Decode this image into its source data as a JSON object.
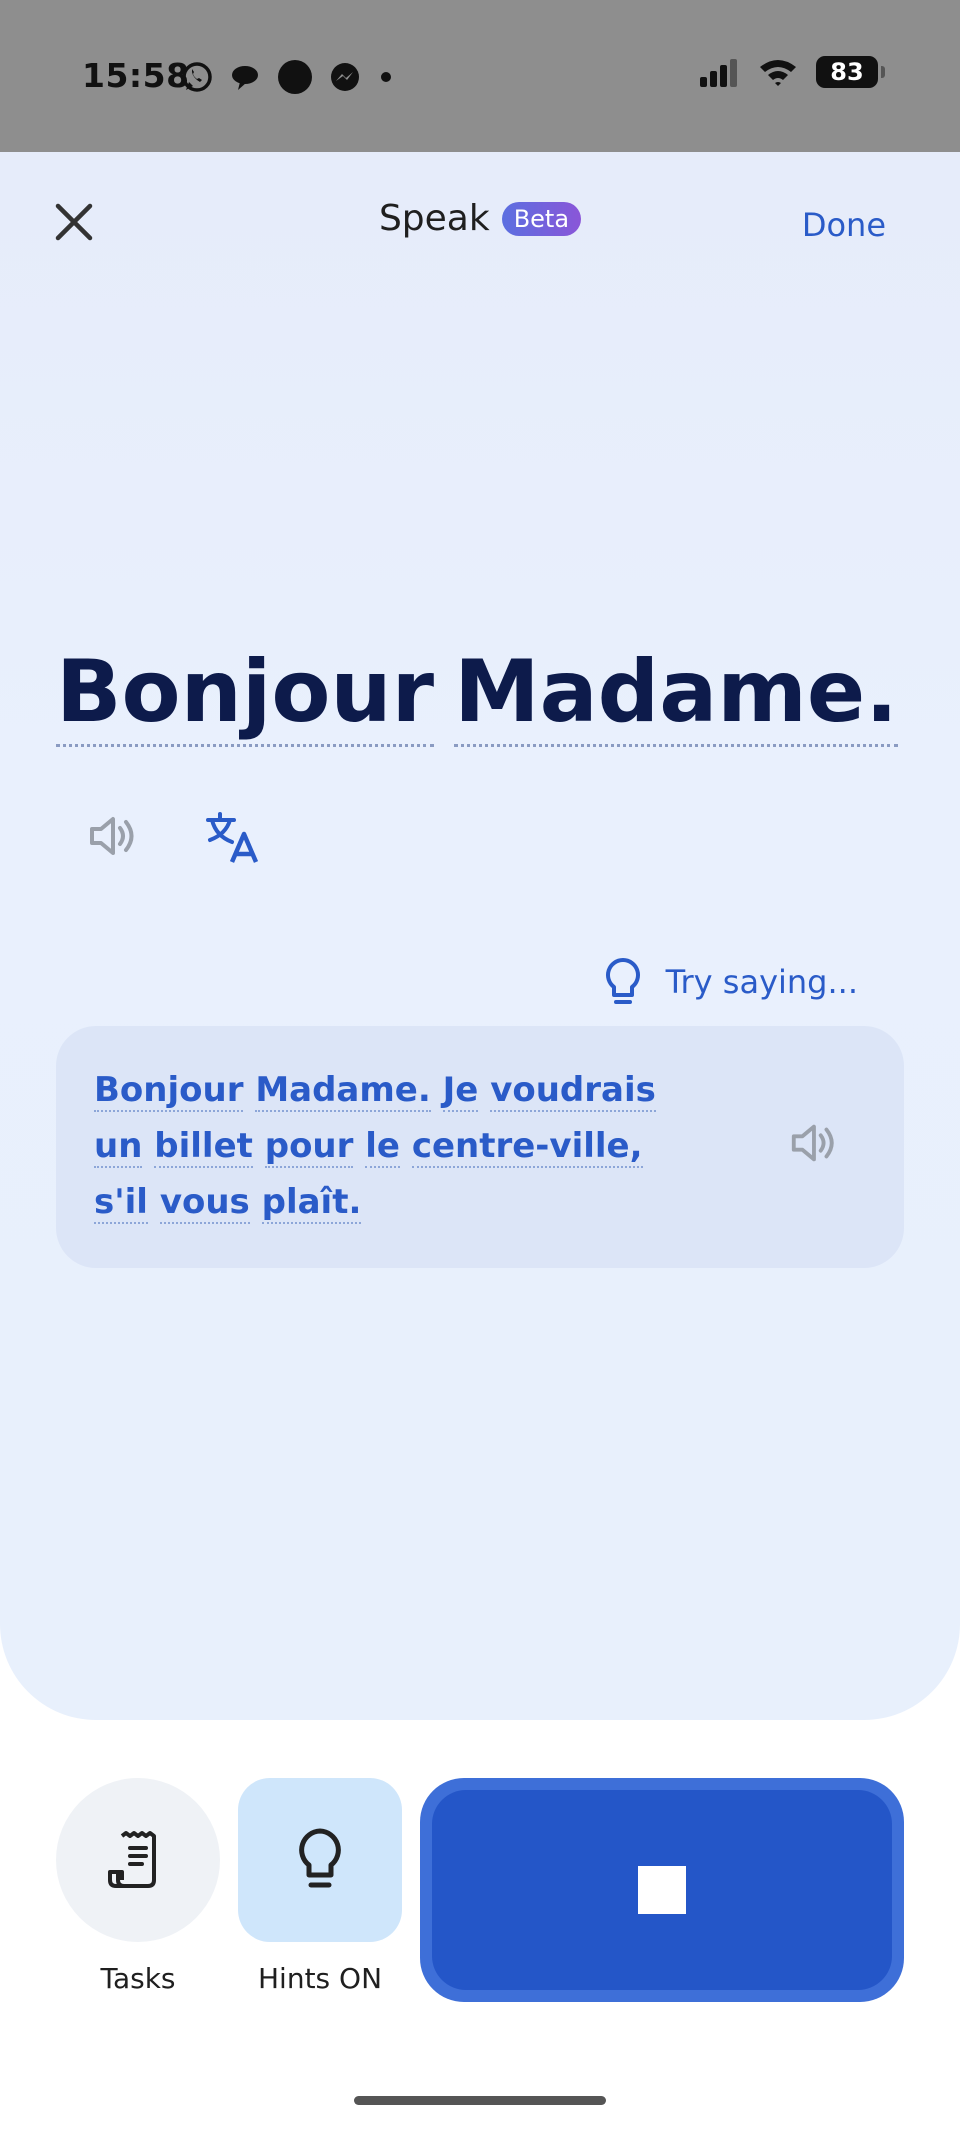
{
  "status_bar": {
    "time": "15:58",
    "battery": "83",
    "left_icons": [
      "whatsapp-icon",
      "chat-bubble-icon",
      "circle-icon",
      "messenger-icon",
      "dot-icon"
    ],
    "right_icons": [
      "signal-icon",
      "wifi-icon",
      "battery-icon"
    ]
  },
  "header": {
    "title": "Speak",
    "badge": "Beta",
    "done_label": "Done"
  },
  "phrase": {
    "words": [
      "Bonjour",
      "Madame."
    ]
  },
  "hint": {
    "label": "Try saying..."
  },
  "suggestion": {
    "words": [
      "Bonjour",
      "Madame.",
      "Je",
      "voudrais",
      "un",
      "billet",
      "pour",
      "le",
      "centre-ville,",
      "s'il",
      "vous",
      "plaît."
    ]
  },
  "bottom": {
    "tasks_label": "Tasks",
    "hints_label": "Hints ON"
  },
  "colors": {
    "accent": "#2a5bc8",
    "record_button": "#2456c8",
    "card_bg": "#dce5f7",
    "sheet_bg": "#e8f0fc"
  }
}
